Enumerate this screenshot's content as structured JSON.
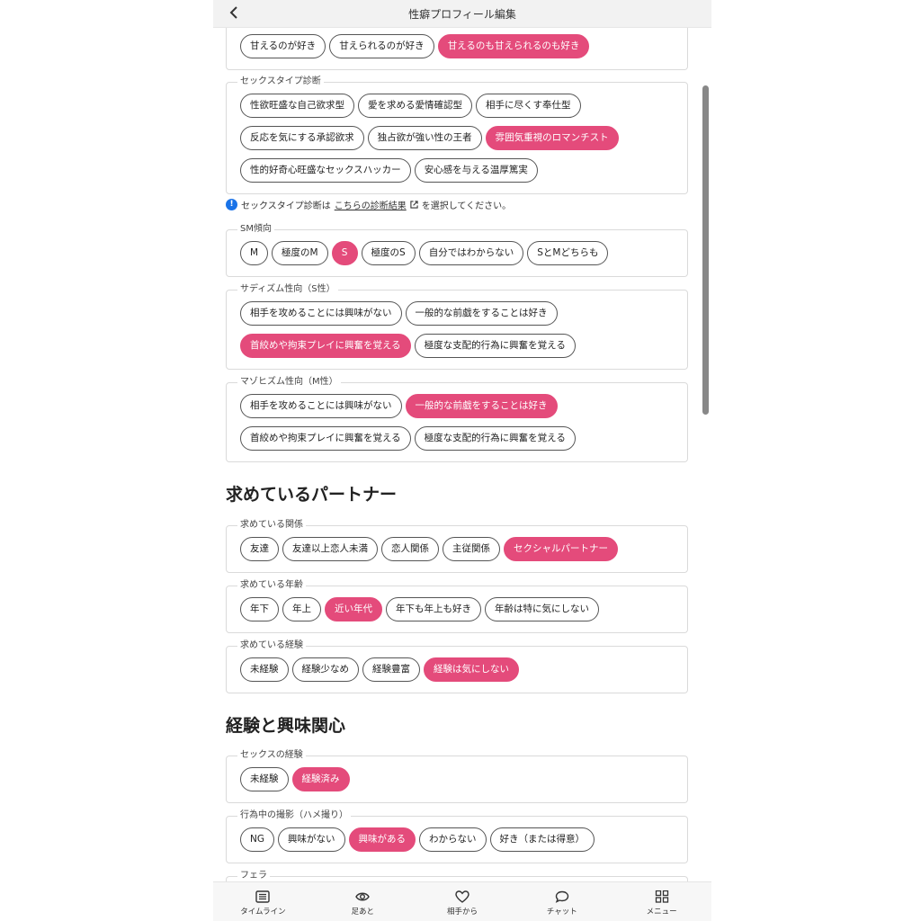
{
  "header": {
    "title": "性癖プロフィール編集"
  },
  "top_row": [
    "甘えるのが好き",
    "甘えられるのが好き",
    "甘えるのも甘えられるのも好き"
  ],
  "sex_type": {
    "label": "セックスタイプ診断",
    "row1": [
      "性欲旺盛な自己欲求型",
      "愛を求める愛情確認型",
      "相手に尽くす奉仕型"
    ],
    "row2": [
      "反応を気にする承認欲求",
      "独占欲が強い性の王者",
      "雰囲気重視のロマンチスト"
    ],
    "row3": [
      "性的好奇心旺盛なセックスハッカー",
      "安心感を与える温厚篤実"
    ]
  },
  "note": {
    "prefix": "セックスタイプ診断は",
    "link": "こちらの診断結果",
    "suffix": "を選択してください。"
  },
  "sm": {
    "label": "SM傾向",
    "options": [
      "M",
      "極度のM",
      "S",
      "極度のS",
      "自分ではわからない",
      "SとMどちらも"
    ]
  },
  "sadism": {
    "label": "サディズム性向（S性）",
    "row1": [
      "相手を攻めることには興味がない",
      "一般的な前戯をすることは好き"
    ],
    "row2": [
      "首絞めや拘束プレイに興奮を覚える",
      "極度な支配的行為に興奮を覚える"
    ]
  },
  "masochism": {
    "label": "マゾヒズム性向（M性）",
    "row1": [
      "相手を攻めることには興味がない",
      "一般的な前戯をすることは好き"
    ],
    "row2": [
      "首絞めや拘束プレイに興奮を覚える",
      "極度な支配的行為に興奮を覚える"
    ]
  },
  "partner_title": "求めているパートナー",
  "relation": {
    "label": "求めている関係",
    "options": [
      "友達",
      "友達以上恋人未満",
      "恋人関係",
      "主従関係",
      "セクシャルパートナー"
    ]
  },
  "age": {
    "label": "求めている年齢",
    "options": [
      "年下",
      "年上",
      "近い年代",
      "年下も年上も好き",
      "年齢は特に気にしない"
    ]
  },
  "experience": {
    "label": "求めている経験",
    "options": [
      "未経験",
      "経験少なめ",
      "経験豊富",
      "経験は気にしない"
    ]
  },
  "interest_title": "経験と興味関心",
  "sex_exp": {
    "label": "セックスの経験",
    "options": [
      "未経験",
      "経験済み"
    ]
  },
  "filming": {
    "label": "行為中の撮影（ハメ撮り）",
    "options": [
      "NG",
      "興味がない",
      "興味がある",
      "わからない",
      "好き（または得意）"
    ]
  },
  "next_label": "フェラ",
  "nav": [
    "タイムライン",
    "足あと",
    "相手から",
    "チャット",
    "メニュー"
  ],
  "colors": {
    "accent": "#e44b7b",
    "info": "#1a73e8"
  }
}
